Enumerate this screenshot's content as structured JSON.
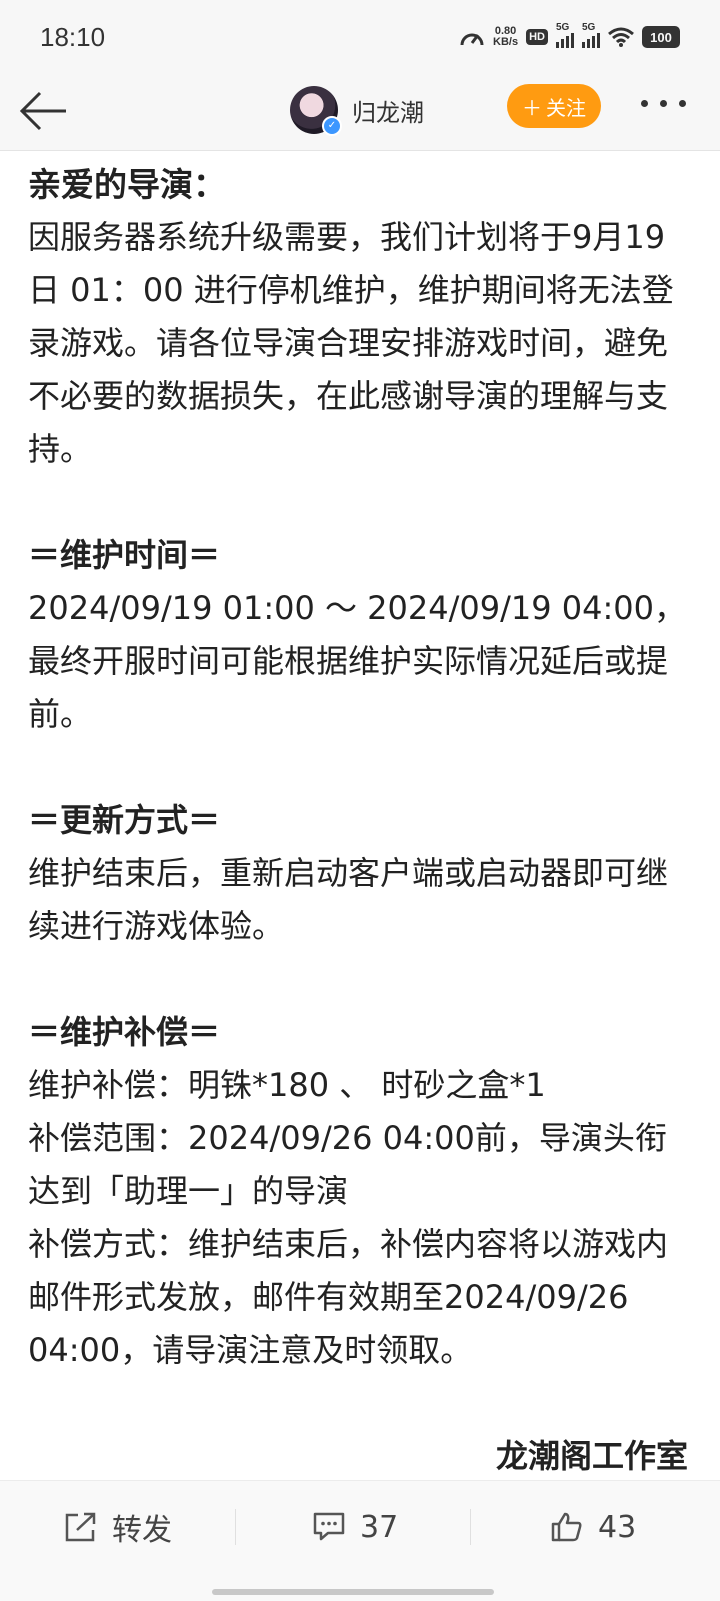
{
  "status_bar": {
    "time": "18:10",
    "net_speed_value": "0.80",
    "net_speed_unit": "KB/s",
    "hd_label": "HD",
    "sim1_label": "5G",
    "sim2_label": "5G",
    "battery": "100"
  },
  "header": {
    "username": "归龙潮",
    "follow_label": "关注",
    "follow_color": "#ff9b11"
  },
  "post": {
    "greeting": "亲爱的导演：",
    "intro": "因服务器系统升级需要，我们计划将于9月19日 01：00 进行停机维护，维护期间将无法登录游戏。请各位导演合理安排游戏时间，避免不必要的数据损失，在此感谢导演的理解与支持。",
    "sections": [
      {
        "title": "＝维护时间＝",
        "lines": [
          "2024/09/19 01:00 ～ 2024/09/19 04:00，最终开服时间可能根据维护实际情况延后或提前。"
        ]
      },
      {
        "title": "＝更新方式＝",
        "lines": [
          "维护结束后，重新启动客户端或启动器即可继续进行游戏体验。"
        ]
      },
      {
        "title": "＝维护补偿＝",
        "lines": [
          "维护补偿：明铢*180 、 时砂之盒*1",
          "补偿范围：2024/09/26 04:00前，导演头衔达到「助理一」的导演",
          "补偿方式：维护结束后，补偿内容将以游戏内邮件形式发放，邮件有效期至2024/09/26 04:00，请导演注意及时领取。"
        ]
      }
    ],
    "signature": "龙潮阁工作室"
  },
  "bottom_bar": {
    "repost_label": "转发",
    "comment_count": "37",
    "like_count": "43"
  }
}
